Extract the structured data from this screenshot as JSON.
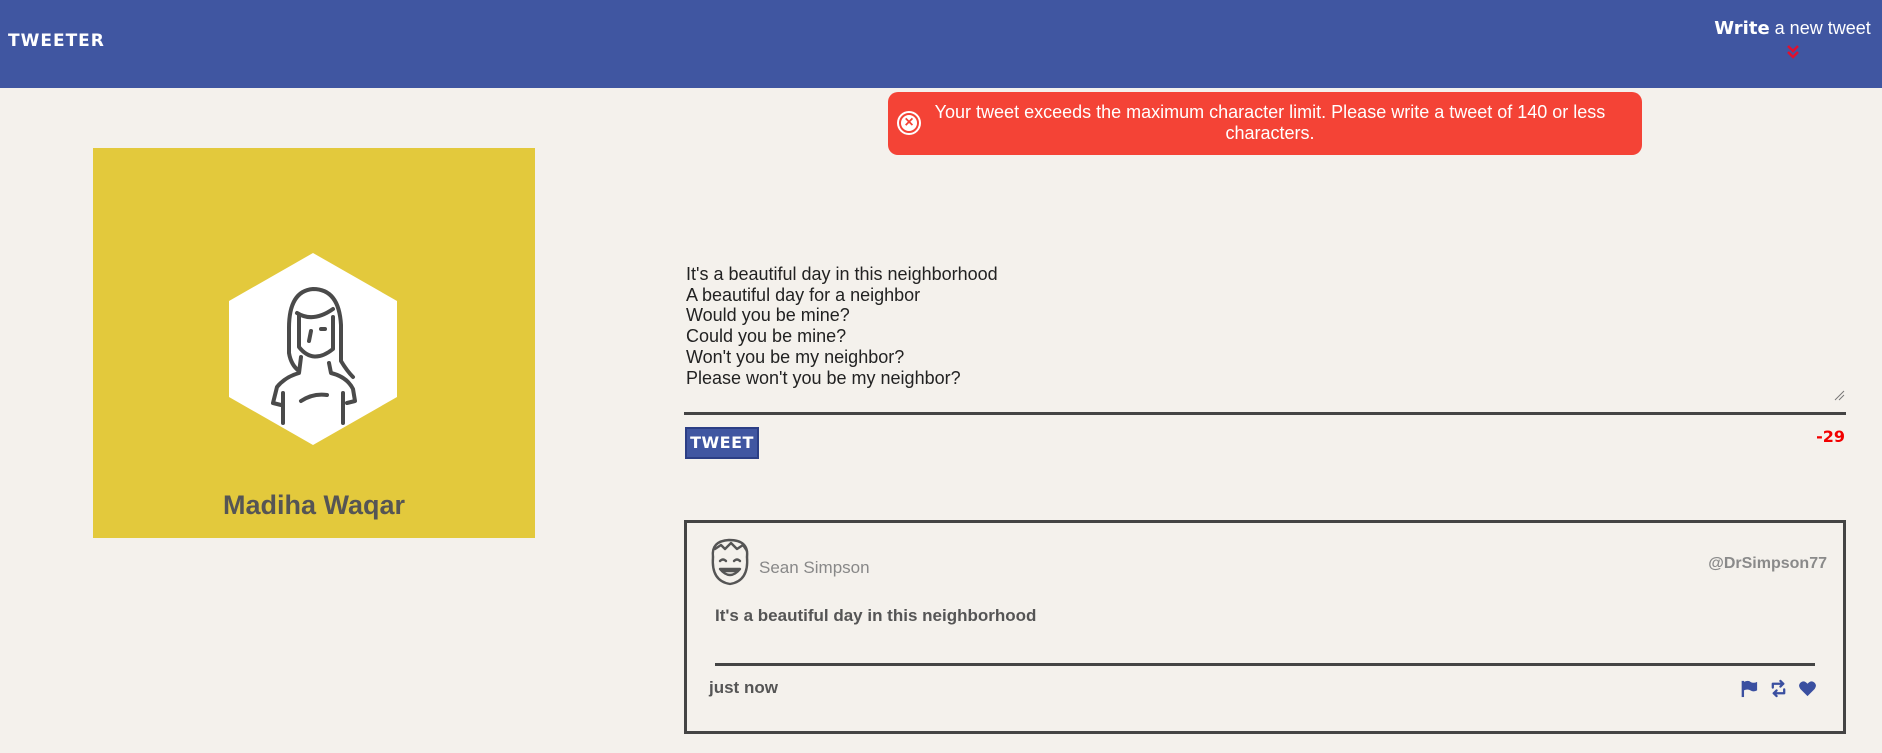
{
  "nav": {
    "brand": "TWEETER",
    "compose_strong": "Write",
    "compose_rest": " a new tweet"
  },
  "error": {
    "message": "Your tweet exceeds the maximum character limit. Please write a tweet of 140 or less characters."
  },
  "profile": {
    "name": "Madiha Waqar"
  },
  "compose": {
    "text": "It's a beautiful day in this neighborhood\nA beautiful day for a neighbor\nWould you be mine?\nCould you be mine?\nWon't you be my neighbor?\nPlease won't you be my neighbor?",
    "button_label": "TWEET",
    "counter": "-29"
  },
  "tweets": [
    {
      "author": "Sean Simpson",
      "handle": "@DrSimpson77",
      "text": "It's a beautiful day in this neighborhood",
      "time": "just now"
    }
  ],
  "colors": {
    "nav": "#4056a1",
    "background": "#f4f1ec",
    "profile": "#e3c93c",
    "error": "#f44336",
    "counter_over": "#f20000"
  },
  "icons": [
    "double-chevron-down-icon",
    "error-close-icon",
    "user-avatar-icon",
    "flag-icon",
    "retweet-icon",
    "heart-icon"
  ]
}
